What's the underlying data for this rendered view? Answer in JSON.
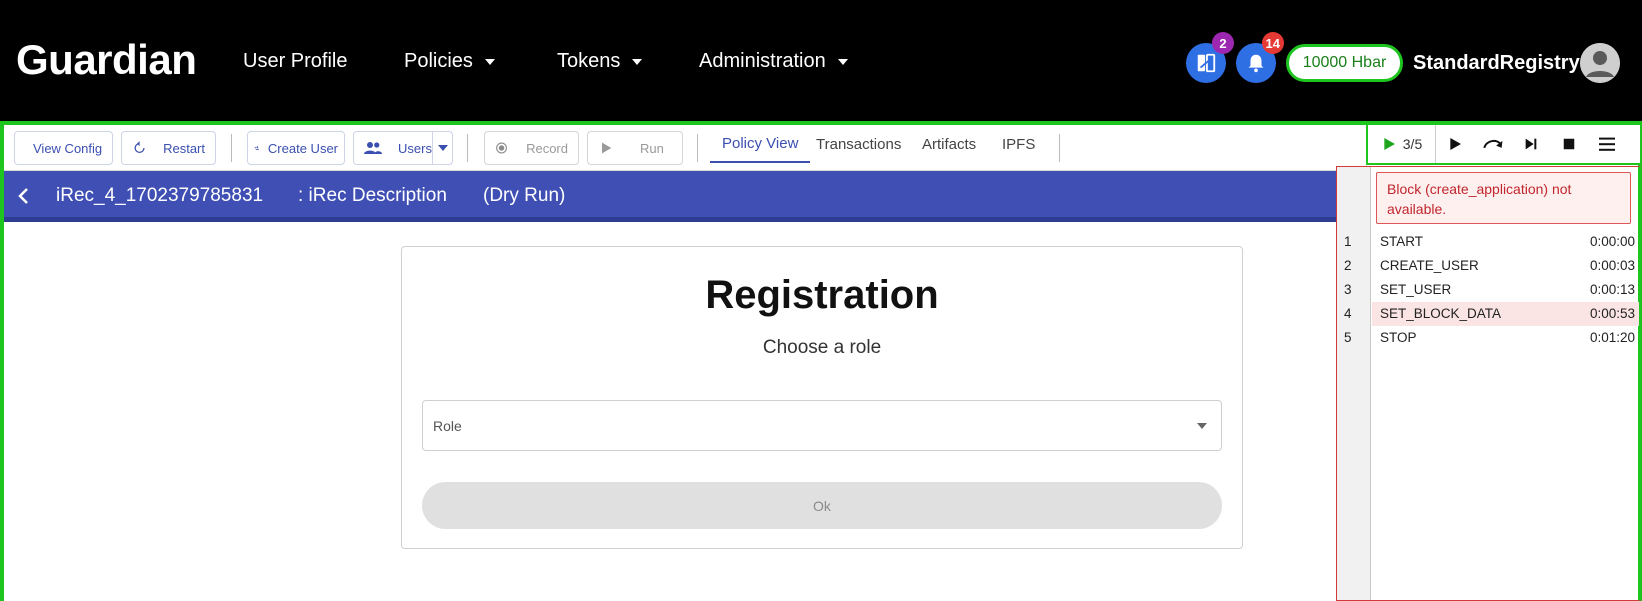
{
  "header": {
    "logo": "Guardian",
    "nav": [
      {
        "label": "User Profile",
        "dropdown": false
      },
      {
        "label": "Policies",
        "dropdown": true
      },
      {
        "label": "Tokens",
        "dropdown": true
      },
      {
        "label": "Administration",
        "dropdown": true
      }
    ],
    "tasks_badge": "2",
    "notifications_badge": "14",
    "balance": "10000 Hbar",
    "username": "StandardRegistry"
  },
  "toolbar": {
    "view_config": "View Config",
    "restart": "Restart",
    "create_user": "Create User",
    "users": "Users",
    "record": "Record",
    "run": "Run",
    "tabs": [
      "Policy View",
      "Transactions",
      "Artifacts",
      "IPFS"
    ],
    "active_tab": "Policy View"
  },
  "debugger": {
    "progress": "3/5"
  },
  "policy": {
    "name": "iRec_4_1702379785831",
    "description": ": iRec Description",
    "mode": "(Dry Run)"
  },
  "registration": {
    "title": "Registration",
    "subtitle": "Choose a role",
    "role_placeholder": "Role",
    "ok_label": "Ok"
  },
  "steps_panel": {
    "error": "Block (create_application) not available.",
    "steps": [
      {
        "num": "1",
        "name": "START",
        "time": "0:00:00",
        "highlighted": false
      },
      {
        "num": "2",
        "name": "CREATE_USER",
        "time": "0:00:03",
        "highlighted": false
      },
      {
        "num": "3",
        "name": "SET_USER",
        "time": "0:00:13",
        "highlighted": false
      },
      {
        "num": "4",
        "name": "SET_BLOCK_DATA",
        "time": "0:00:53",
        "highlighted": true
      },
      {
        "num": "5",
        "name": "STOP",
        "time": "0:01:20",
        "highlighted": false
      }
    ]
  },
  "colors": {
    "primary": "#3f4fb3",
    "accent_green": "#1ec51e",
    "error_red": "#c0262d"
  }
}
